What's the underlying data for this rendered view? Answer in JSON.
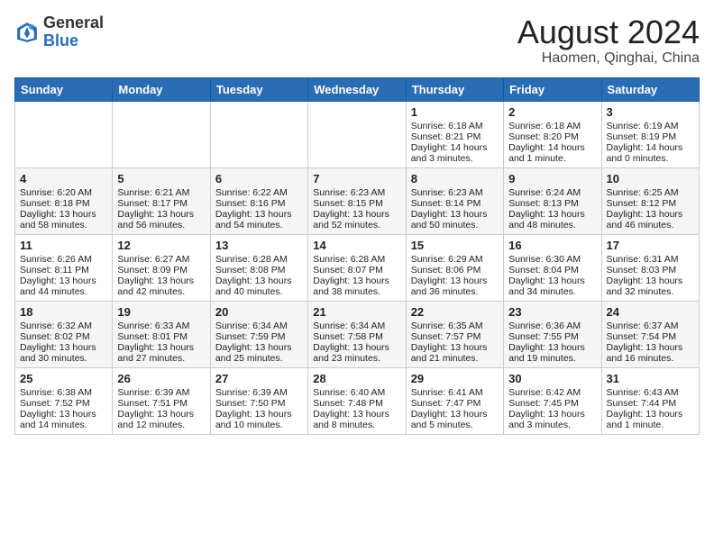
{
  "header": {
    "logo_line1": "General",
    "logo_line2": "Blue",
    "month_title": "August 2024",
    "location": "Haomen, Qinghai, China"
  },
  "weekdays": [
    "Sunday",
    "Monday",
    "Tuesday",
    "Wednesday",
    "Thursday",
    "Friday",
    "Saturday"
  ],
  "weeks": [
    [
      {
        "day": "",
        "empty": true
      },
      {
        "day": "",
        "empty": true
      },
      {
        "day": "",
        "empty": true
      },
      {
        "day": "",
        "empty": true
      },
      {
        "day": "1",
        "sunrise": "6:18 AM",
        "sunset": "8:21 PM",
        "daylight": "14 hours and 3 minutes."
      },
      {
        "day": "2",
        "sunrise": "6:18 AM",
        "sunset": "8:20 PM",
        "daylight": "14 hours and 1 minute."
      },
      {
        "day": "3",
        "sunrise": "6:19 AM",
        "sunset": "8:19 PM",
        "daylight": "14 hours and 0 minutes."
      }
    ],
    [
      {
        "day": "4",
        "sunrise": "6:20 AM",
        "sunset": "8:18 PM",
        "daylight": "13 hours and 58 minutes."
      },
      {
        "day": "5",
        "sunrise": "6:21 AM",
        "sunset": "8:17 PM",
        "daylight": "13 hours and 56 minutes."
      },
      {
        "day": "6",
        "sunrise": "6:22 AM",
        "sunset": "8:16 PM",
        "daylight": "13 hours and 54 minutes."
      },
      {
        "day": "7",
        "sunrise": "6:23 AM",
        "sunset": "8:15 PM",
        "daylight": "13 hours and 52 minutes."
      },
      {
        "day": "8",
        "sunrise": "6:23 AM",
        "sunset": "8:14 PM",
        "daylight": "13 hours and 50 minutes."
      },
      {
        "day": "9",
        "sunrise": "6:24 AM",
        "sunset": "8:13 PM",
        "daylight": "13 hours and 48 minutes."
      },
      {
        "day": "10",
        "sunrise": "6:25 AM",
        "sunset": "8:12 PM",
        "daylight": "13 hours and 46 minutes."
      }
    ],
    [
      {
        "day": "11",
        "sunrise": "6:26 AM",
        "sunset": "8:11 PM",
        "daylight": "13 hours and 44 minutes."
      },
      {
        "day": "12",
        "sunrise": "6:27 AM",
        "sunset": "8:09 PM",
        "daylight": "13 hours and 42 minutes."
      },
      {
        "day": "13",
        "sunrise": "6:28 AM",
        "sunset": "8:08 PM",
        "daylight": "13 hours and 40 minutes."
      },
      {
        "day": "14",
        "sunrise": "6:28 AM",
        "sunset": "8:07 PM",
        "daylight": "13 hours and 38 minutes."
      },
      {
        "day": "15",
        "sunrise": "6:29 AM",
        "sunset": "8:06 PM",
        "daylight": "13 hours and 36 minutes."
      },
      {
        "day": "16",
        "sunrise": "6:30 AM",
        "sunset": "8:04 PM",
        "daylight": "13 hours and 34 minutes."
      },
      {
        "day": "17",
        "sunrise": "6:31 AM",
        "sunset": "8:03 PM",
        "daylight": "13 hours and 32 minutes."
      }
    ],
    [
      {
        "day": "18",
        "sunrise": "6:32 AM",
        "sunset": "8:02 PM",
        "daylight": "13 hours and 30 minutes."
      },
      {
        "day": "19",
        "sunrise": "6:33 AM",
        "sunset": "8:01 PM",
        "daylight": "13 hours and 27 minutes."
      },
      {
        "day": "20",
        "sunrise": "6:34 AM",
        "sunset": "7:59 PM",
        "daylight": "13 hours and 25 minutes."
      },
      {
        "day": "21",
        "sunrise": "6:34 AM",
        "sunset": "7:58 PM",
        "daylight": "13 hours and 23 minutes."
      },
      {
        "day": "22",
        "sunrise": "6:35 AM",
        "sunset": "7:57 PM",
        "daylight": "13 hours and 21 minutes."
      },
      {
        "day": "23",
        "sunrise": "6:36 AM",
        "sunset": "7:55 PM",
        "daylight": "13 hours and 19 minutes."
      },
      {
        "day": "24",
        "sunrise": "6:37 AM",
        "sunset": "7:54 PM",
        "daylight": "13 hours and 16 minutes."
      }
    ],
    [
      {
        "day": "25",
        "sunrise": "6:38 AM",
        "sunset": "7:52 PM",
        "daylight": "13 hours and 14 minutes."
      },
      {
        "day": "26",
        "sunrise": "6:39 AM",
        "sunset": "7:51 PM",
        "daylight": "13 hours and 12 minutes."
      },
      {
        "day": "27",
        "sunrise": "6:39 AM",
        "sunset": "7:50 PM",
        "daylight": "13 hours and 10 minutes."
      },
      {
        "day": "28",
        "sunrise": "6:40 AM",
        "sunset": "7:48 PM",
        "daylight": "13 hours and 8 minutes."
      },
      {
        "day": "29",
        "sunrise": "6:41 AM",
        "sunset": "7:47 PM",
        "daylight": "13 hours and 5 minutes."
      },
      {
        "day": "30",
        "sunrise": "6:42 AM",
        "sunset": "7:45 PM",
        "daylight": "13 hours and 3 minutes."
      },
      {
        "day": "31",
        "sunrise": "6:43 AM",
        "sunset": "7:44 PM",
        "daylight": "13 hours and 1 minute."
      }
    ]
  ]
}
